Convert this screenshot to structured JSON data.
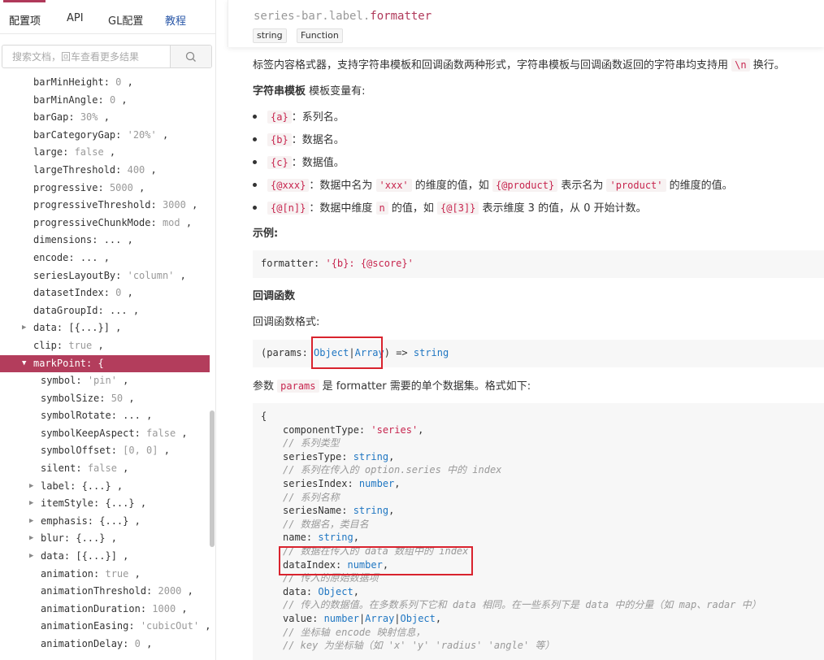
{
  "tabs": {
    "config": "配置项",
    "api": "API",
    "gl": "GL配置",
    "tutorial": "教程"
  },
  "search": {
    "placeholder": "搜索文档，回车查看更多结果"
  },
  "tree": [
    {
      "key": "barMinHeight",
      "val": "0",
      "vtype": "num",
      "indent": 1
    },
    {
      "key": "barMinAngle",
      "val": "0",
      "vtype": "num",
      "indent": 1
    },
    {
      "key": "barGap",
      "val": "30%",
      "vtype": "num",
      "indent": 1
    },
    {
      "key": "barCategoryGap",
      "val": "'20%'",
      "vtype": "str",
      "indent": 1
    },
    {
      "key": "large",
      "val": "false",
      "vtype": "bool",
      "indent": 1
    },
    {
      "key": "largeThreshold",
      "val": "400",
      "vtype": "num",
      "indent": 1
    },
    {
      "key": "progressive",
      "val": "5000",
      "vtype": "num",
      "indent": 1
    },
    {
      "key": "progressiveThreshold",
      "val": "3000",
      "vtype": "num",
      "indent": 1
    },
    {
      "key": "progressiveChunkMode",
      "val": "mod",
      "vtype": "num",
      "indent": 1
    },
    {
      "key": "dimensions",
      "val": "...",
      "vtype": "plain",
      "indent": 1
    },
    {
      "key": "encode",
      "val": "...",
      "vtype": "plain",
      "indent": 1
    },
    {
      "key": "seriesLayoutBy",
      "val": "'column'",
      "vtype": "str",
      "indent": 1
    },
    {
      "key": "datasetIndex",
      "val": "0",
      "vtype": "num",
      "indent": 1
    },
    {
      "key": "dataGroupId",
      "val": "...",
      "vtype": "plain",
      "indent": 1
    },
    {
      "key": "data",
      "val": "[{...}]",
      "vtype": "plain",
      "indent": 1,
      "caret": "right"
    },
    {
      "key": "clip",
      "val": "true",
      "vtype": "bool",
      "indent": 1
    },
    {
      "key": "markPoint",
      "val": "{",
      "vtype": "plain",
      "indent": 1,
      "caret": "down",
      "selected": true,
      "nocomma": true
    },
    {
      "key": "symbol",
      "val": "'pin'",
      "vtype": "str",
      "indent": 2
    },
    {
      "key": "symbolSize",
      "val": "50",
      "vtype": "num",
      "indent": 2
    },
    {
      "key": "symbolRotate",
      "val": "...",
      "vtype": "plain",
      "indent": 2
    },
    {
      "key": "symbolKeepAspect",
      "val": "false",
      "vtype": "bool",
      "indent": 2
    },
    {
      "key": "symbolOffset",
      "val": "[0, 0]",
      "vtype": "num",
      "indent": 2
    },
    {
      "key": "silent",
      "val": "false",
      "vtype": "bool",
      "indent": 2
    },
    {
      "key": "label",
      "val": "{...}",
      "vtype": "plain",
      "indent": 2,
      "caret": "right"
    },
    {
      "key": "itemStyle",
      "val": "{...}",
      "vtype": "plain",
      "indent": 2,
      "caret": "right"
    },
    {
      "key": "emphasis",
      "val": "{...}",
      "vtype": "plain",
      "indent": 2,
      "caret": "right"
    },
    {
      "key": "blur",
      "val": "{...}",
      "vtype": "plain",
      "indent": 2,
      "caret": "right"
    },
    {
      "key": "data",
      "val": "[{...}]",
      "vtype": "plain",
      "indent": 2,
      "caret": "right"
    },
    {
      "key": "animation",
      "val": "true",
      "vtype": "bool",
      "indent": 2
    },
    {
      "key": "animationThreshold",
      "val": "2000",
      "vtype": "num",
      "indent": 2
    },
    {
      "key": "animationDuration",
      "val": "1000",
      "vtype": "num",
      "indent": 2
    },
    {
      "key": "animationEasing",
      "val": "'cubicOut'",
      "vtype": "str",
      "indent": 2
    },
    {
      "key": "animationDelay",
      "val": "0",
      "vtype": "num",
      "indent": 2
    }
  ],
  "header": {
    "path_prefix": "series-bar.label.",
    "path_last": "formatter",
    "types": [
      "string",
      "Function"
    ]
  },
  "doc": {
    "intro_1": "标签内容格式器，支持字符串模板和回调函数两种形式，字符串模板与回调函数返回的字符串均支持用",
    "intro_code": "\\n",
    "intro_2": "换行。",
    "tpl_bold": "字符串模板",
    "tpl_rest": "模板变量有:",
    "bullets": [
      {
        "code": "{a}",
        "text": "：系列名。"
      },
      {
        "code": "{b}",
        "text": "：数据名。"
      },
      {
        "code": "{c}",
        "text": "：数据值。"
      }
    ],
    "b4_code1": "{@xxx}",
    "b4_t1": "：数据中名为",
    "b4_code2": "'xxx'",
    "b4_t2": "的维度的值，如",
    "b4_code3": "{@product}",
    "b4_t3": "表示名为",
    "b4_code4": "'product'",
    "b4_t4": "的维度的值。",
    "b5_code1": "{@[n]}",
    "b5_t1": "：数据中维度",
    "b5_code2": "n",
    "b5_t2": "的值，如",
    "b5_code3": "{@[3]}",
    "b5_t3": "表示维度 3 的值，从 0 开始计数。",
    "example_label": "示例:",
    "example_key": "formatter: ",
    "example_val": "'{b}: {@score}'",
    "callback_title": "回调函数",
    "callback_format": "回调函数格式:",
    "sig_1": "(params: ",
    "sig_obj": "Object",
    "sig_pipe": "|",
    "sig_arr": "Array",
    "sig_2": ") => ",
    "sig_str": "string",
    "params_1": "参数",
    "params_code": "params",
    "params_2": "是 formatter 需要的单个数据集。格式如下:"
  },
  "code_lines": [
    {
      "parts": [
        [
          "p",
          "{"
        ]
      ],
      "indent": 0
    },
    {
      "parts": [
        [
          "p",
          "componentType: "
        ],
        [
          "s",
          "'series'"
        ],
        [
          "p",
          ","
        ]
      ],
      "indent": 1
    },
    {
      "parts": [
        [
          "c",
          "// 系列类型"
        ]
      ],
      "indent": 1
    },
    {
      "parts": [
        [
          "p",
          "seriesType: "
        ],
        [
          "k",
          "string"
        ],
        [
          "p",
          ","
        ]
      ],
      "indent": 1
    },
    {
      "parts": [
        [
          "c",
          "// 系列在传入的 option.series 中的 index"
        ]
      ],
      "indent": 1
    },
    {
      "parts": [
        [
          "p",
          "seriesIndex: "
        ],
        [
          "k",
          "number"
        ],
        [
          "p",
          ","
        ]
      ],
      "indent": 1
    },
    {
      "parts": [
        [
          "c",
          "// 系列名称"
        ]
      ],
      "indent": 1
    },
    {
      "parts": [
        [
          "p",
          "seriesName: "
        ],
        [
          "k",
          "string"
        ],
        [
          "p",
          ","
        ]
      ],
      "indent": 1
    },
    {
      "parts": [
        [
          "c",
          "// 数据名，类目名"
        ]
      ],
      "indent": 1
    },
    {
      "parts": [
        [
          "p",
          "name: "
        ],
        [
          "k",
          "string"
        ],
        [
          "p",
          ","
        ]
      ],
      "indent": 1
    },
    {
      "parts": [
        [
          "c",
          "// 数据在传入的 data 数组中的 index"
        ]
      ],
      "indent": 1
    },
    {
      "parts": [
        [
          "p",
          "dataIndex: "
        ],
        [
          "k",
          "number"
        ],
        [
          "p",
          ","
        ]
      ],
      "indent": 1
    },
    {
      "parts": [
        [
          "c",
          "// 传入的原始数据项"
        ]
      ],
      "indent": 1
    },
    {
      "parts": [
        [
          "p",
          "data: "
        ],
        [
          "k",
          "Object"
        ],
        [
          "p",
          ","
        ]
      ],
      "indent": 1
    },
    {
      "parts": [
        [
          "c",
          "// 传入的数据值。在多数系列下它和 data 相同。在一些系列下是 data 中的分量（如 map、radar 中）"
        ]
      ],
      "indent": 1
    },
    {
      "parts": [
        [
          "p",
          "value: "
        ],
        [
          "k",
          "number"
        ],
        [
          "p",
          "|"
        ],
        [
          "k",
          "Array"
        ],
        [
          "p",
          "|"
        ],
        [
          "k",
          "Object"
        ],
        [
          "p",
          ","
        ]
      ],
      "indent": 1
    },
    {
      "parts": [
        [
          "c",
          "// 坐标轴 encode 映射信息，"
        ]
      ],
      "indent": 1
    },
    {
      "parts": [
        [
          "c",
          "// key 为坐标轴（如 'x' 'y' 'radius' 'angle' 等）"
        ]
      ],
      "indent": 1
    }
  ]
}
